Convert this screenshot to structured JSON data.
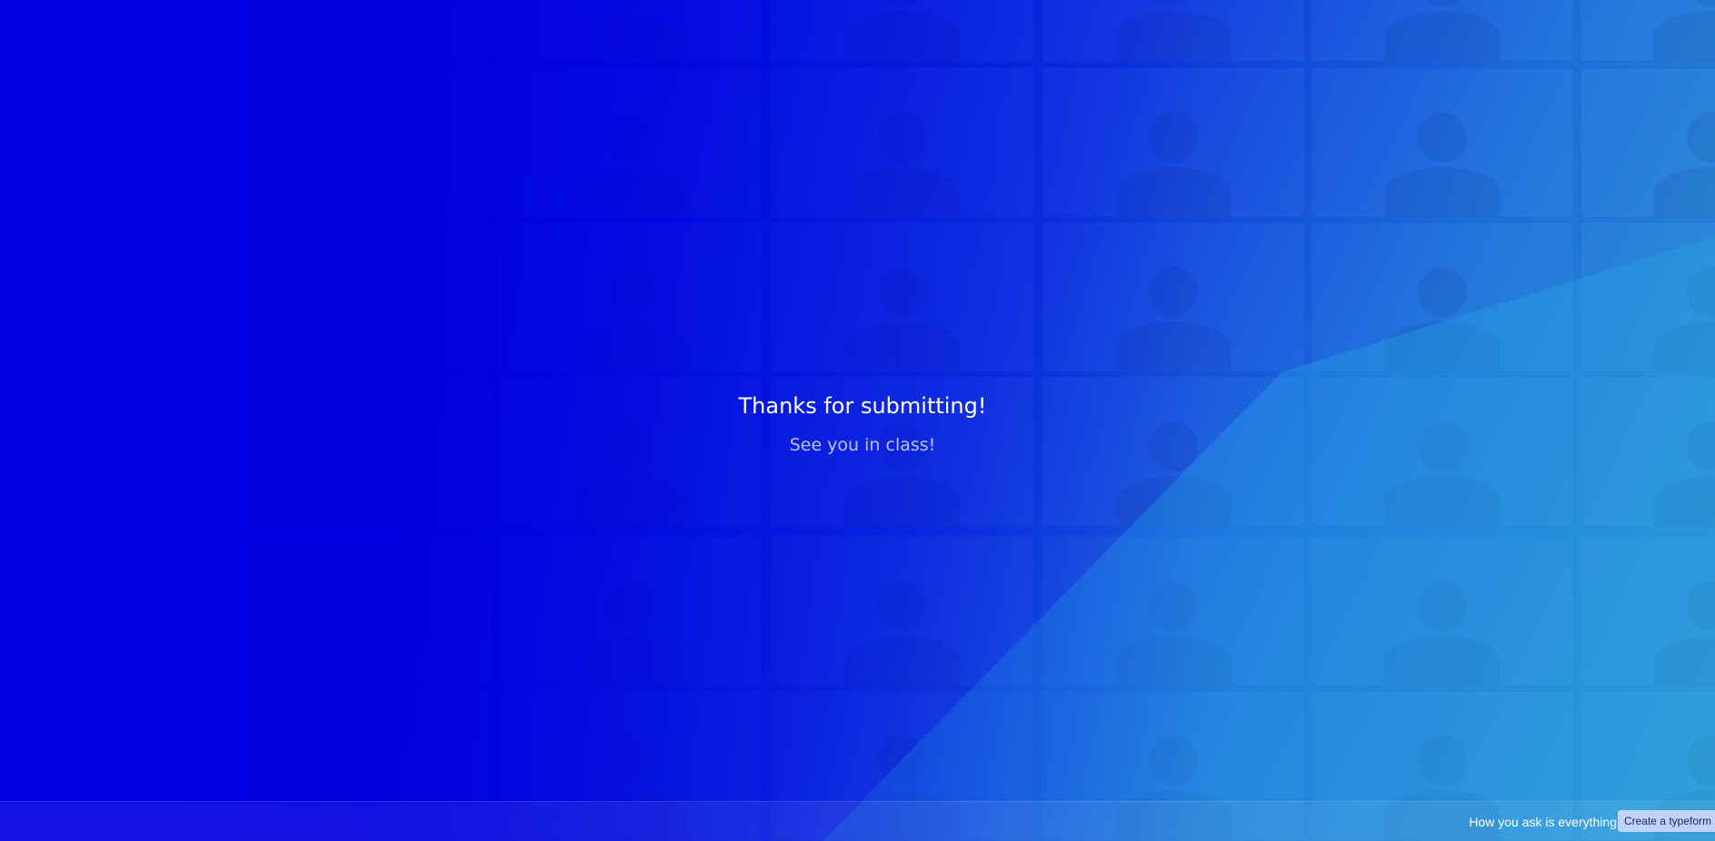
{
  "thanks": {
    "title": "Thanks for submitting!",
    "subtitle": "See you in class!"
  },
  "footer": {
    "tagline": "How you ask is everything",
    "button_label": "Create a typeform"
  },
  "colors": {
    "background_start": "#0000e0",
    "background_end": "#2a9ad4",
    "button_bg": "#bfd3ff"
  }
}
